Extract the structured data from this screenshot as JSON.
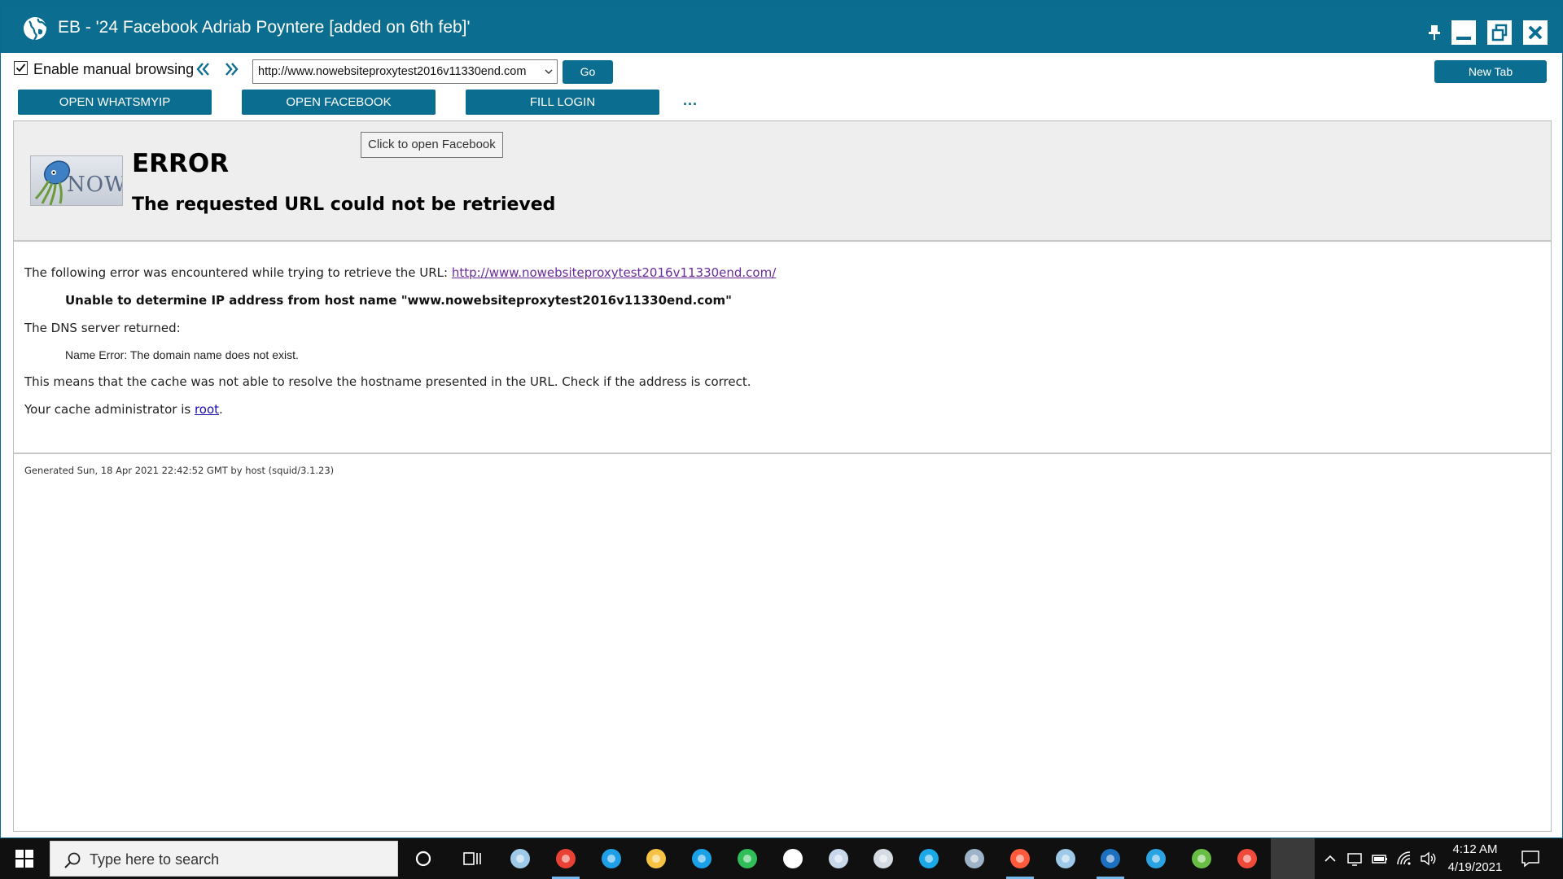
{
  "window": {
    "title": "EB - '24 Facebook Adriab Poyntere [added on 6th feb]'"
  },
  "toolbar": {
    "manual_browsing_label": "Enable manual browsing",
    "manual_browsing_checked": true,
    "url_value": "http://www.nowebsiteproxytest2016v11330end.com",
    "go_label": "Go",
    "new_tab_label": "New Tab",
    "open_whatsmyip_label": "OPEN WHATSMYIP",
    "open_facebook_label": "OPEN FACEBOOK",
    "fill_login_label": "FILL LOGIN",
    "more_label": "..."
  },
  "tooltip": {
    "text": "Click to open Facebook"
  },
  "error_page": {
    "logo_text": "NOW",
    "title": "ERROR",
    "subtitle": "The requested URL could not be retrieved",
    "following_prefix": "The following error was encountered while trying to retrieve the URL: ",
    "error_url": "http://www.nowebsiteproxytest2016v11330end.com/",
    "unable_message": "Unable to determine IP address from host name \"www.nowebsiteproxytest2016v11330end.com\"",
    "dns_returned": "The DNS server returned:",
    "name_error": "Name Error: The domain name does not exist.",
    "means_message": "This means that the cache was not able to resolve the hostname presented in the URL. Check if the address is correct.",
    "admin_prefix": "Your cache administrator is ",
    "admin_link": "root",
    "admin_suffix": ".",
    "generated": "Generated Sun, 18 Apr 2021 22:42:52 GMT by host (squid/3.1.23)"
  },
  "taskbar": {
    "search_placeholder": "Type here to search",
    "time": "4:12 AM",
    "date": "4/19/2021",
    "apps": [
      {
        "name": "glass-app-icon",
        "color": "#9ec9e8"
      },
      {
        "name": "chrome-icon",
        "color": "#e94235"
      },
      {
        "name": "edge-icon",
        "color": "#1fa0e6"
      },
      {
        "name": "file-explorer-icon",
        "color": "#f6c344"
      },
      {
        "name": "skype-icon",
        "color": "#1aa1e6"
      },
      {
        "name": "evernote-icon",
        "color": "#2fbe58"
      },
      {
        "name": "settings-icon",
        "color": "#ffffff"
      },
      {
        "name": "paint-icon",
        "color": "#c9d7ea"
      },
      {
        "name": "scanner-icon",
        "color": "#d5dbe2"
      },
      {
        "name": "browser-swirl-icon",
        "color": "#1aa8e6"
      },
      {
        "name": "calculator-icon",
        "color": "#9fb3c8"
      },
      {
        "name": "media-player-icon",
        "color": "#ff5a3c"
      },
      {
        "name": "glass-app-2-icon",
        "color": "#9ec9e8"
      },
      {
        "name": "outlook-calendar-icon",
        "color": "#1d6fbf"
      },
      {
        "name": "telegram-icon",
        "color": "#2aa3e2"
      },
      {
        "name": "utorrent-icon",
        "color": "#68bd45"
      },
      {
        "name": "screen-recorder-icon",
        "color": "#f04a3a"
      }
    ]
  },
  "colors": {
    "accent": "#0b6e90",
    "taskbar": "#101010",
    "visited_link": "#6b2a9a",
    "link": "#1a0dab"
  }
}
